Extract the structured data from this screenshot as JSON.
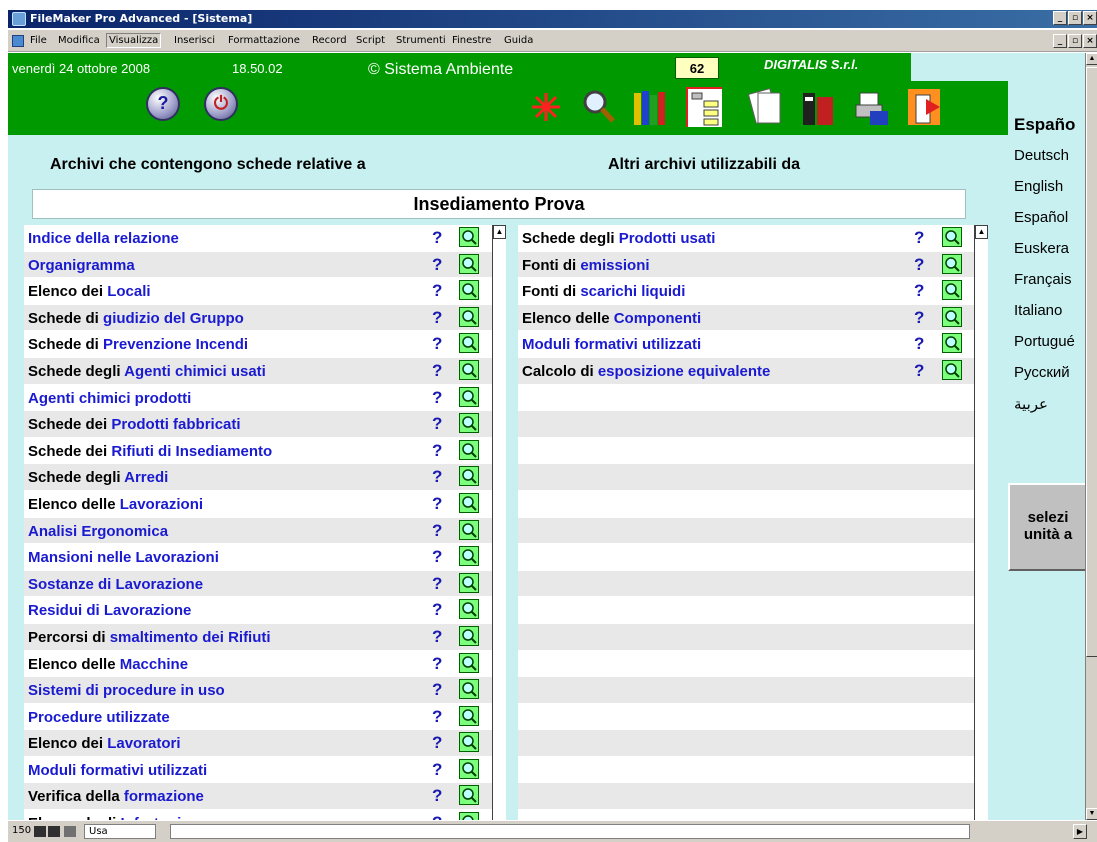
{
  "window": {
    "title": "FileMaker Pro Advanced - [Sistema]"
  },
  "menu": {
    "items": [
      "File",
      "Modifica",
      "Visualizza",
      "Inserisci",
      "Formattazione",
      "Record",
      "Script",
      "Strumenti",
      "Finestre",
      "Guida"
    ],
    "active": "Visualizza"
  },
  "header": {
    "date": "venerdì 24 ottobre 2008",
    "time": "18.50.02",
    "brand": "© Sistema Ambiente",
    "counter": "62",
    "company": "DIGITALIS S.r.l."
  },
  "toolbar": {
    "icons": [
      "help-icon",
      "exit-icon",
      "asterisk-icon",
      "magnifier-icon",
      "binders-icon",
      "tree-list-icon",
      "documents-icon",
      "archive-icon",
      "printer-icon",
      "door-exit-icon"
    ]
  },
  "headings": {
    "left": "Archivi che contengono schede relative a",
    "right": "Altri archivi utilizzabili da",
    "settlement": "Insediamento Prova"
  },
  "left_list": [
    {
      "prefix": "",
      "link": "Indice della relazione"
    },
    {
      "prefix": "",
      "link": "Organigramma"
    },
    {
      "prefix": "Elenco dei ",
      "link": "Locali"
    },
    {
      "prefix": "Schede di ",
      "link": "giudizio del Gruppo"
    },
    {
      "prefix": "Schede di ",
      "link": "Prevenzione Incendi"
    },
    {
      "prefix": "Schede degli ",
      "link": "Agenti chimici usati"
    },
    {
      "prefix": "",
      "link": "Agenti chimici prodotti"
    },
    {
      "prefix": "Schede dei ",
      "link": "Prodotti fabbricati"
    },
    {
      "prefix": "Schede dei ",
      "link": "Rifiuti di Insediamento"
    },
    {
      "prefix": "Schede degli ",
      "link": "Arredi"
    },
    {
      "prefix": "Elenco delle ",
      "link": "Lavorazioni"
    },
    {
      "prefix": "",
      "link": "Analisi Ergonomica"
    },
    {
      "prefix": "",
      "link": "Mansioni nelle Lavorazioni"
    },
    {
      "prefix": "",
      "link": "Sostanze di Lavorazione"
    },
    {
      "prefix": "",
      "link": "Residui di Lavorazione"
    },
    {
      "prefix": "Percorsi di ",
      "link": "smaltimento dei Rifiuti"
    },
    {
      "prefix": "Elenco delle ",
      "link": "Macchine"
    },
    {
      "prefix": "",
      "link": "Sistemi di procedure in uso"
    },
    {
      "prefix": "",
      "link": "Procedure utilizzate"
    },
    {
      "prefix": "Elenco dei ",
      "link": "Lavoratori"
    },
    {
      "prefix": "",
      "link": "Moduli formativi utilizzati"
    },
    {
      "prefix": "Verifica della ",
      "link": "formazione"
    },
    {
      "prefix": "Elenco degli ",
      "link": "Infortuni"
    }
  ],
  "right_list": [
    {
      "prefix": "Schede degli ",
      "link": "Prodotti usati"
    },
    {
      "prefix": "Fonti di ",
      "link": "emissioni"
    },
    {
      "prefix": "Fonti di ",
      "link": "scarichi liquidi"
    },
    {
      "prefix": "Elenco delle ",
      "link": "Componenti"
    },
    {
      "prefix": "",
      "link": "Moduli formativi utilizzati"
    },
    {
      "prefix": "Calcolo di ",
      "link": "esposizione equivalente"
    }
  ],
  "help_mark": "?",
  "languages": {
    "title": "Españo",
    "items": [
      "Deutsch",
      "English",
      "Español",
      "Euskera",
      "Français",
      "Italiano",
      "Portugué",
      "Русский",
      "عربية"
    ]
  },
  "select_button": {
    "line1": "selezi",
    "line2": "unità a"
  },
  "statusbar": {
    "zoom": "150",
    "mode": "Usa"
  }
}
